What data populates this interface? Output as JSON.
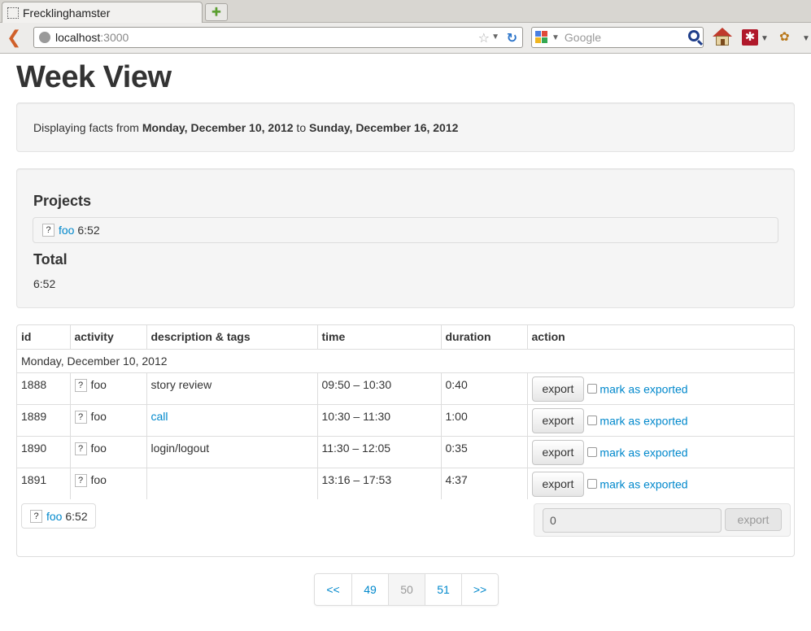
{
  "browser": {
    "tab_title": "Frecklinghamster",
    "url_host": "localhost",
    "url_port": ":3000",
    "search_placeholder": "Google"
  },
  "page": {
    "title": "Week View",
    "range": {
      "prefix": "Displaying facts from ",
      "start": "Monday, December 10, 2012",
      "middle": " to ",
      "end": "Sunday, December 16, 2012"
    },
    "summary": {
      "projects_heading": "Projects",
      "projects": [
        {
          "icon": "?",
          "name": "foo",
          "duration": "6:52"
        }
      ],
      "total_heading": "Total",
      "total_value": "6:52"
    },
    "table": {
      "headers": [
        "id",
        "activity",
        "description & tags",
        "time",
        "duration",
        "action"
      ],
      "day_label": "Monday, December 10, 2012",
      "rows": [
        {
          "id": "1888",
          "activity": "foo",
          "description": "story review",
          "desc_is_link": false,
          "time": "09:50 – 10:30",
          "duration": "0:40"
        },
        {
          "id": "1889",
          "activity": "foo",
          "description": "call",
          "desc_is_link": true,
          "time": "10:30 – 11:30",
          "duration": "1:00"
        },
        {
          "id": "1890",
          "activity": "foo",
          "description": "login/logout",
          "desc_is_link": false,
          "time": "11:30 – 12:05",
          "duration": "0:35"
        },
        {
          "id": "1891",
          "activity": "foo",
          "description": "",
          "desc_is_link": false,
          "time": "13:16 – 17:53",
          "duration": "4:37"
        }
      ],
      "export_label": "export",
      "mark_label": "mark as exported",
      "activity_icon": "?",
      "footer_project": {
        "icon": "?",
        "name": "foo",
        "duration": "6:52"
      },
      "export_count": "0",
      "export_all_label": "export"
    },
    "pagination": {
      "items": [
        "<<",
        "49",
        "50",
        "51",
        ">>"
      ],
      "current": "50"
    }
  },
  "colors": {
    "link": "#0088cc",
    "well_bg": "#f5f5f5",
    "border": "#dddddd"
  }
}
